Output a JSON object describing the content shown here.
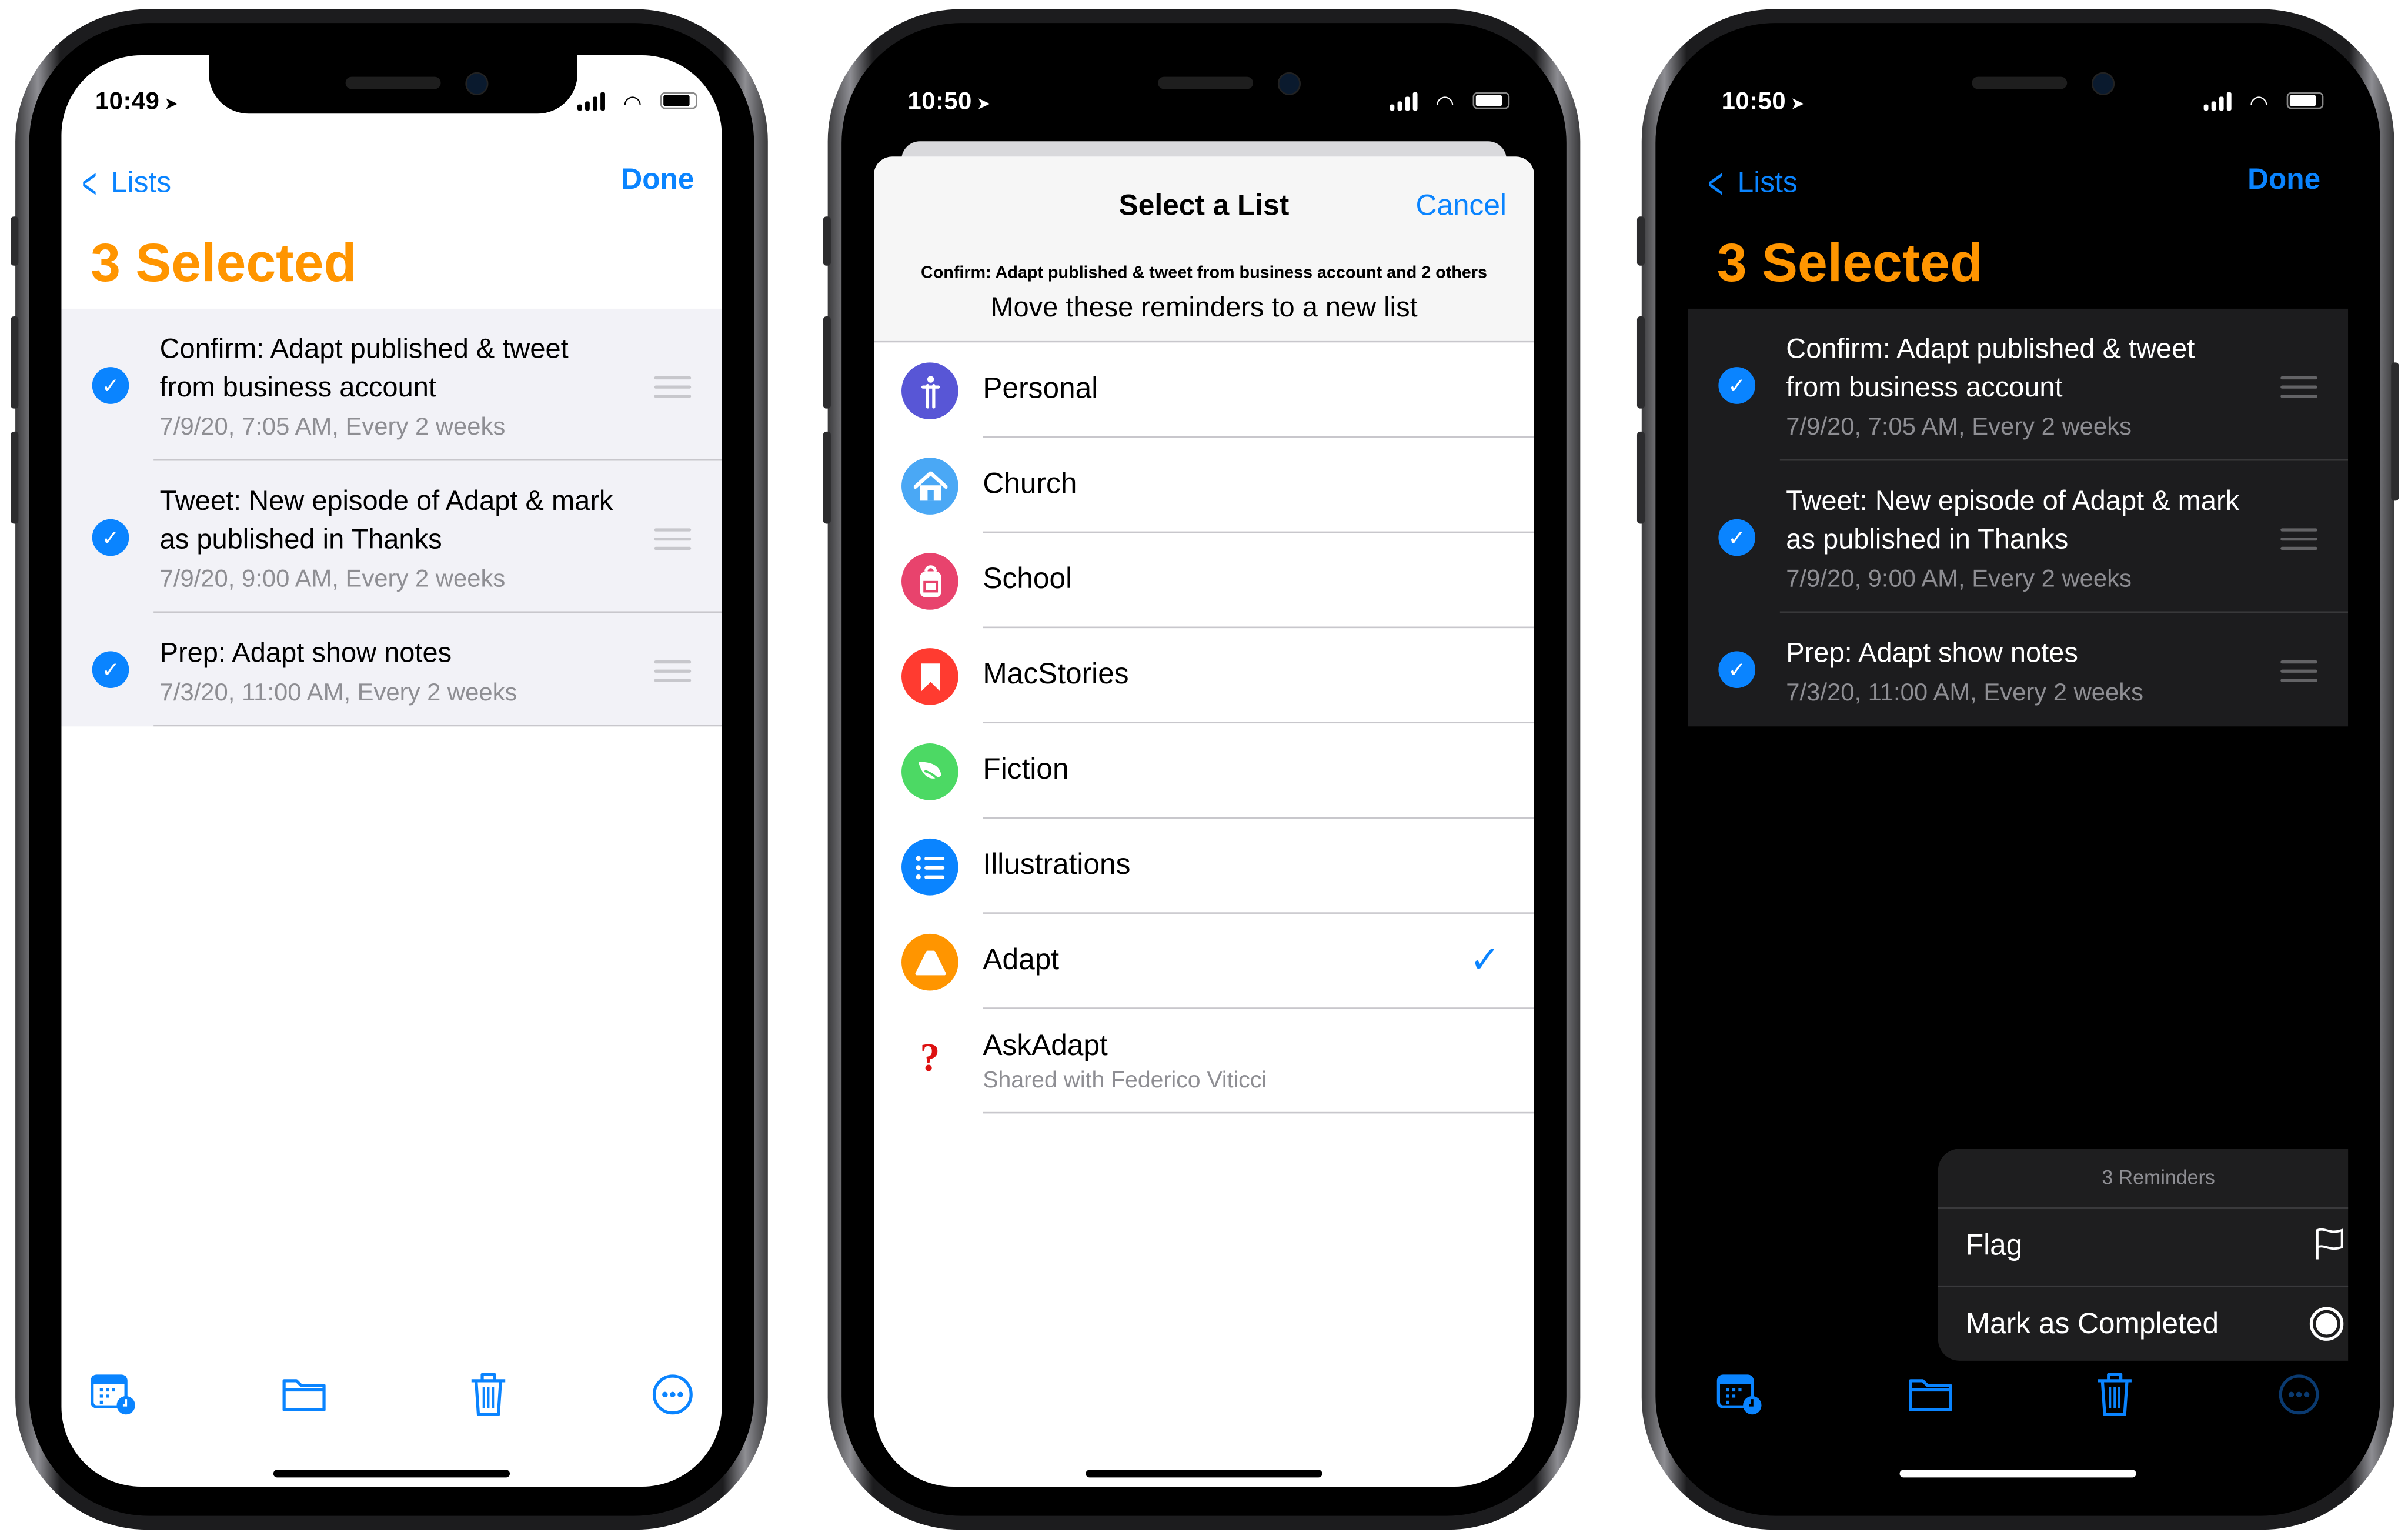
{
  "phones": {
    "left": {
      "theme": "light",
      "status": {
        "time": "10:49"
      },
      "nav": {
        "back_label": "Lists",
        "done_label": "Done"
      },
      "title": "3 Selected",
      "reminders": [
        {
          "title": "Confirm: Adapt published & tweet from business account",
          "subtitle": "7/9/20, 7:05 AM, Every 2 weeks",
          "selected": true
        },
        {
          "title": "Tweet: New episode of Adapt & mark as published in Thanks",
          "subtitle": "7/9/20, 9:00 AM, Every 2 weeks",
          "selected": true
        },
        {
          "title": "Prep: Adapt show notes",
          "subtitle": "7/3/20, 11:00 AM, Every 2 weeks",
          "selected": true
        }
      ],
      "toolbar": [
        "calendar-clock-icon",
        "folder-icon",
        "trash-icon",
        "ellipsis-circle-icon"
      ]
    },
    "middle": {
      "status": {
        "time": "10:50"
      },
      "sheet": {
        "title": "Select a List",
        "cancel_label": "Cancel",
        "reminder_summary": "Confirm: Adapt published & tweet from business account and 2 others",
        "prompt": "Move these reminders to a new list",
        "lists": [
          {
            "name": "Personal",
            "icon": "person-icon",
            "color": "#5856d6"
          },
          {
            "name": "Church",
            "icon": "house-icon",
            "color": "#4aa8f5"
          },
          {
            "name": "School",
            "icon": "backpack-icon",
            "color": "#e8436d"
          },
          {
            "name": "MacStories",
            "icon": "bookmark-icon",
            "color": "#ff3b30"
          },
          {
            "name": "Fiction",
            "icon": "leaf-icon",
            "color": "#4cd964"
          },
          {
            "name": "Illustrations",
            "icon": "list-icon",
            "color": "#0a84ff"
          },
          {
            "name": "Adapt",
            "icon": "triangle-icon",
            "color": "#ff9500",
            "checked": true
          },
          {
            "name": "AskAdapt",
            "icon": "question-mark-icon",
            "color": "#dd1111",
            "subtitle": "Shared with Federico Viticci"
          }
        ]
      }
    },
    "right": {
      "theme": "dark",
      "status": {
        "time": "10:50"
      },
      "nav": {
        "back_label": "Lists",
        "done_label": "Done"
      },
      "title": "3 Selected",
      "reminders": [
        {
          "title": "Confirm: Adapt published & tweet from business account",
          "subtitle": "7/9/20, 7:05 AM, Every 2 weeks",
          "selected": true
        },
        {
          "title": "Tweet: New episode of Adapt & mark as published in Thanks",
          "subtitle": "7/9/20, 9:00 AM, Every 2 weeks",
          "selected": true
        },
        {
          "title": "Prep: Adapt show notes",
          "subtitle": "7/3/20, 11:00 AM, Every 2 weeks",
          "selected": true
        }
      ],
      "menu": {
        "header": "3 Reminders",
        "items": [
          {
            "label": "Flag",
            "icon": "flag-icon"
          },
          {
            "label": "Mark as Completed",
            "icon": "completed-circle-icon"
          }
        ]
      }
    }
  },
  "colors": {
    "accent": "#0a84ff",
    "title_orange": "#ff9500"
  }
}
